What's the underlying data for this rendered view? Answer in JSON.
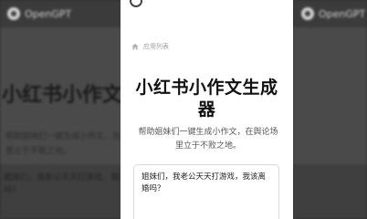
{
  "background": {
    "brand": "OpenGPT",
    "title_left": "小红书小作文生成器",
    "desc_left_line1": "帮助姐妹们一键生成小作文，在舆论场",
    "desc_left_line2": "里立于不败之地。",
    "input_text_line1": "姐妹们，我老公天天打游戏，我该离婚",
    "input_text_line2": "吗？"
  },
  "card": {
    "breadcrumb": "应用列表",
    "title_line1": "小红书小作文生成",
    "title_line2": "器",
    "description": "帮助姐妹们一键生成小作文，在舆论场里立于不败之地。",
    "input_text": "姐妹们，我老公天天打游戏，我该离婚吗？"
  },
  "colors": {
    "background": "#2e2e2e",
    "card": "#ffffff",
    "title": "#111111",
    "muted": "#9aa0a6"
  }
}
